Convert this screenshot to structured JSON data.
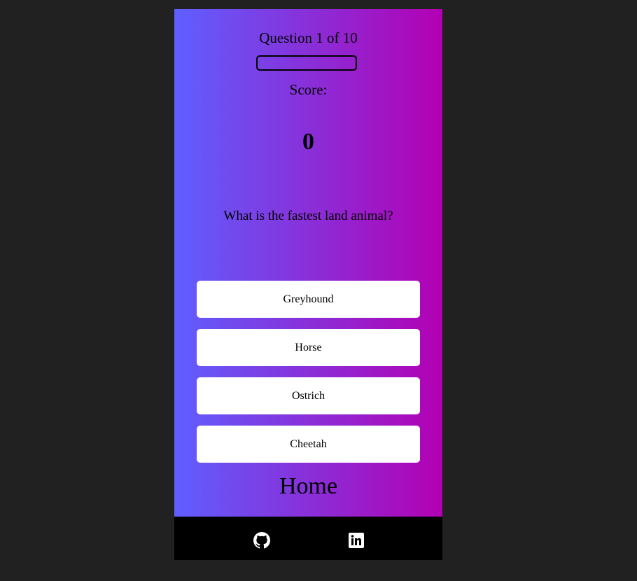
{
  "header": {
    "question_counter": "Question 1 of 10",
    "progress_percent": 0,
    "score_label": "Score:",
    "score_value": "0"
  },
  "question": {
    "text": "What is the fastest land animal?"
  },
  "answers": [
    "Greyhound",
    "Horse",
    "Ostrich",
    "Cheetah"
  ],
  "nav": {
    "home_label": "Home"
  },
  "footer": {
    "icons": [
      "github-icon",
      "linkedin-icon"
    ]
  },
  "colors": {
    "gradient_start": "#5f5fff",
    "gradient_end": "#b300b3",
    "footer_bg": "#000000",
    "page_bg": "#212121"
  }
}
